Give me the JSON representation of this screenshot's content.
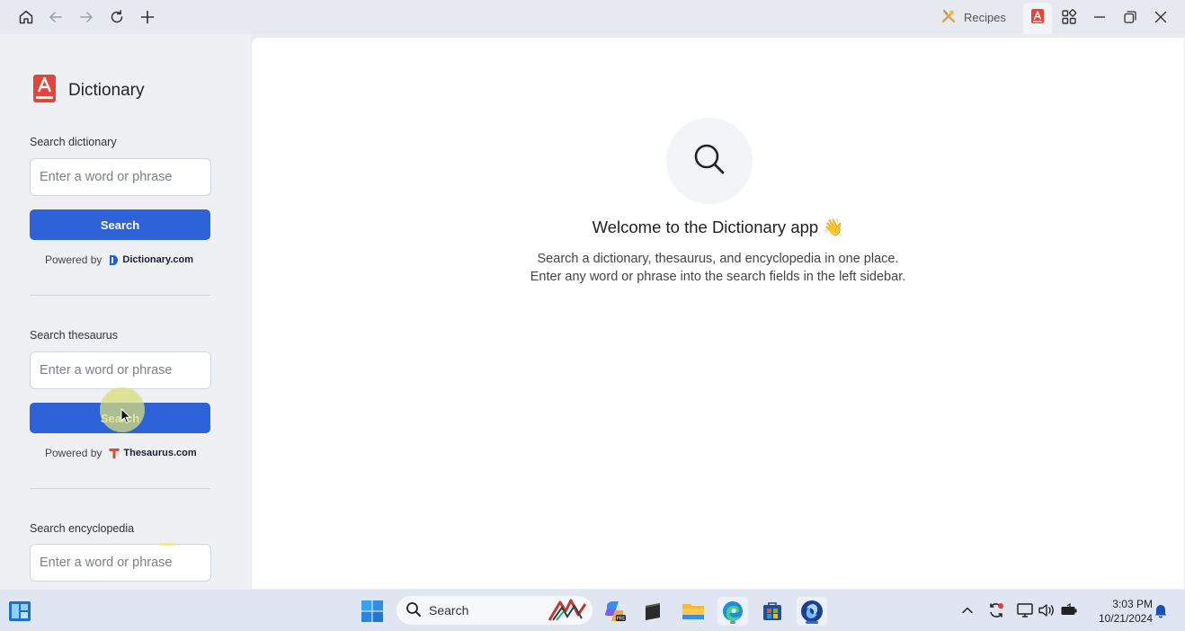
{
  "topbar": {
    "tabs": [
      {
        "label": "Recipes",
        "icon": "recipes-icon"
      },
      {
        "label": "",
        "icon": "dictionary-app-icon",
        "active": true
      }
    ],
    "nav_icons": [
      "home-icon",
      "back-icon",
      "forward-icon",
      "refresh-icon",
      "new-tab-icon"
    ],
    "window_icons": [
      "apps-grid-icon",
      "minimize-icon",
      "restore-icon",
      "close-icon"
    ]
  },
  "sidebar": {
    "app_title": "Dictionary",
    "sections": [
      {
        "label": "Search dictionary",
        "placeholder": "Enter a word or phrase",
        "button": "Search",
        "powered_by": "Powered by",
        "provider": "Dictionary.com"
      },
      {
        "label": "Search thesaurus",
        "placeholder": "Enter a word or phrase",
        "button": "Search",
        "powered_by": "Powered by",
        "provider": "Thesaurus.com"
      },
      {
        "label": "Search encyclopedia",
        "placeholder": "Enter a word or phrase"
      }
    ]
  },
  "main": {
    "welcome": "Welcome to the Dictionary app 👋",
    "line1": "Search a dictionary, thesaurus, and encyclopedia in one place.",
    "line2": "Enter any word or phrase into the search fields in the left sidebar."
  },
  "taskbar": {
    "search_label": "Search",
    "apps": [
      "widgets-icon",
      "start-icon",
      "copilot-icon",
      "terminal-icon",
      "file-explorer-icon",
      "edge-icon",
      "store-icon",
      "app-icon"
    ],
    "time": "3:03 PM",
    "date": "10/21/2024"
  },
  "colors": {
    "accent": "#2e62d9",
    "brand_red": "#e2453c",
    "sidebar_bg": "#eef0f4"
  }
}
